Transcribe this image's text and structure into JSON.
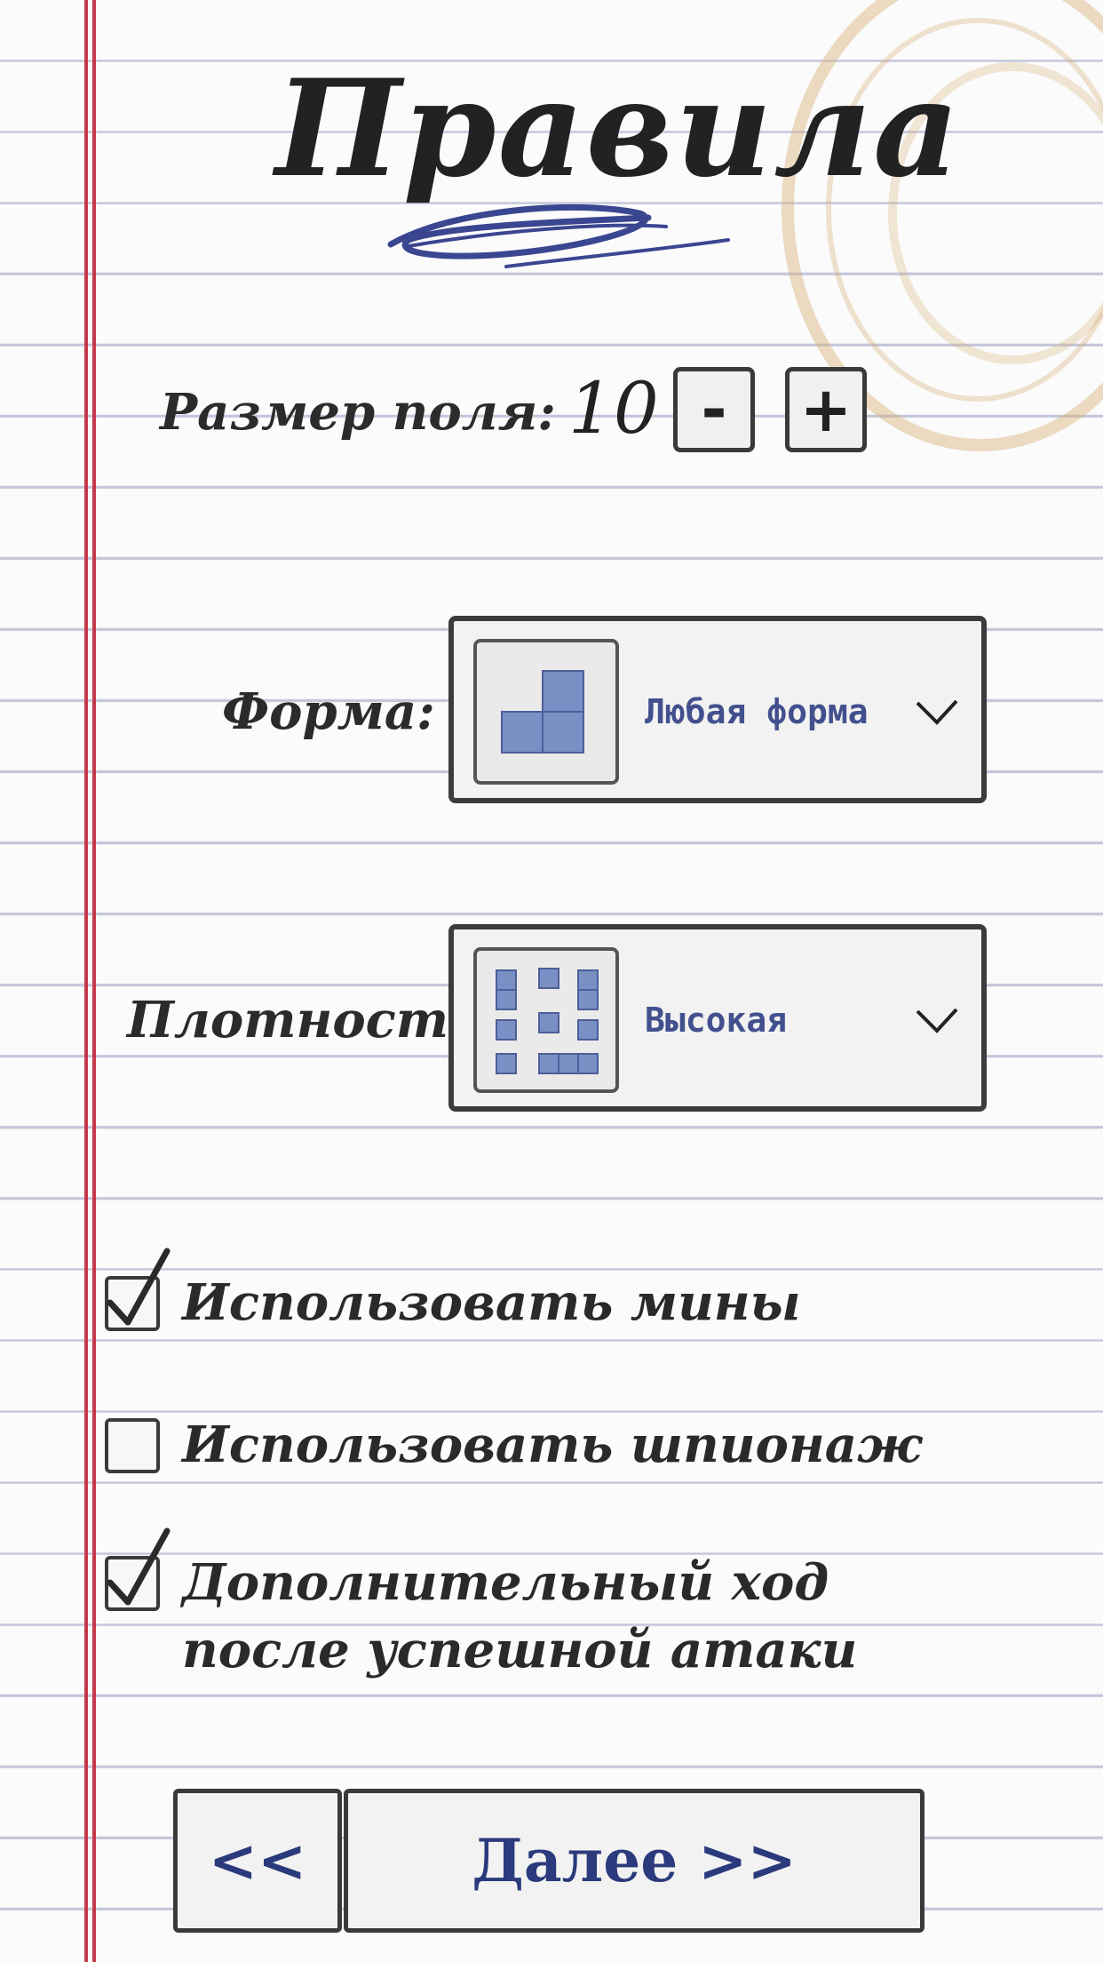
{
  "header": {
    "title": "Правила"
  },
  "field_size": {
    "label": "Размер поля:",
    "value": "10",
    "minus_label": "-",
    "plus_label": "+"
  },
  "shape": {
    "label": "Форма:",
    "selected": "Любая форма"
  },
  "density": {
    "label": "Плотность:",
    "selected": "Высокая"
  },
  "options": [
    {
      "label": "Использовать мины",
      "checked": true
    },
    {
      "label": "Использовать шпионаж",
      "checked": false
    },
    {
      "label": "Дополнительный ход после успешной атаки",
      "checked": true
    }
  ],
  "nav": {
    "back_label": "<<",
    "next_label": "Далее >>"
  },
  "colors": {
    "ink": "#2e2e2e",
    "accent": "#2a3a7c",
    "margin": "#c43a4c",
    "tile": "#7a90c4"
  }
}
